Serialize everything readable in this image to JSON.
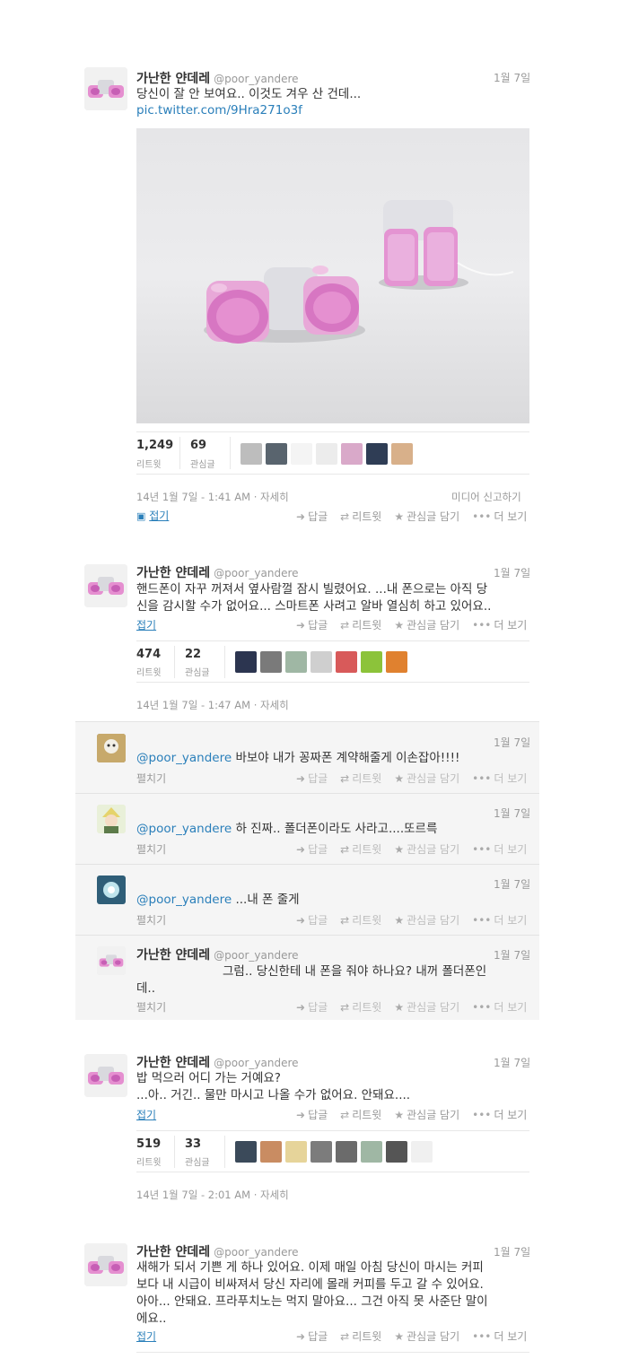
{
  "author": {
    "name": "가난한 얀데레",
    "handle": "@poor_yandere"
  },
  "ui": {
    "reply": "답글",
    "retweet": "리트윗",
    "favorite": "관심글 담기",
    "more": "더 보기",
    "collapse": "접기",
    "expand": "펼치기",
    "retweet_label": "리트윗",
    "favorite_label": "관심글",
    "detail": "자세히",
    "report_media": "미디어 신고하기"
  },
  "tweet1": {
    "date": "1월 7일",
    "text": "당신이 잘 안 보여요.. 이것도 겨우 산 건데...",
    "link": "pic.twitter.com/9Hra271o3f",
    "retweets": "1,249",
    "favorites": "69",
    "timestamp": "14년 1월 7일 - 1:41 AM · 자세히"
  },
  "tweet2": {
    "date": "1월 7일",
    "text": "핸드폰이 자꾸 꺼져서 옆사람껄 잠시 빌렸어요. ...내 폰으로는 아직 당\n신을 감시할 수가 없어요... 스마트폰 사려고 알바 열심히 하고 있어요..",
    "retweets": "474",
    "favorites": "22",
    "timestamp": "14년 1월 7일 - 1:47 AM · 자세히"
  },
  "replies": [
    {
      "date": "1월 7일",
      "mention": "@poor_yandere",
      "text": " 바보야 내가 꽁짜폰 계약해줄게 이손잡아!!!!"
    },
    {
      "date": "1월 7일",
      "mention": "@poor_yandere",
      "text": " 하 진짜.. 폴더폰이라도 사라고....또르륵"
    },
    {
      "date": "1월 7일",
      "mention": "@poor_yandere",
      "text": " ...내 폰 줄게"
    }
  ],
  "reply_self": {
    "date": "1월 7일",
    "text_line1": "그럼.. 당신한테 내 폰을 줘야 하나요? 내꺼 폴더폰인",
    "text_line2": "데.."
  },
  "tweet3": {
    "date": "1월 7일",
    "text": "밥 먹으러 어디 가는 거예요?\n...아.. 거긴.. 물만 마시고 나올 수가 없어요. 안돼요....",
    "retweets": "519",
    "favorites": "33",
    "timestamp": "14년 1월 7일 - 2:01 AM · 자세히"
  },
  "tweet4": {
    "date": "1월 7일",
    "text": "새해가 되서 기쁜 게 하나 있어요. 이제 매일 아침 당신이 마시는 커피\n보다 내 시급이 비싸져서 당신 자리에 몰래 커피를 두고 갈 수 있어요.\n아아... 안돼요. 프라푸치노는 먹지 말아요... 그건 아직 못 사준단 말이\n에요.."
  },
  "colors": {
    "link": "#2a7fba",
    "muted": "#999999",
    "pink": "#e58fd0",
    "gray_plastic": "#e4e4e8"
  },
  "icons": [
    "photo-icon",
    "reply-arrow-icon",
    "retweet-icon",
    "star-icon",
    "more-dots-icon"
  ]
}
